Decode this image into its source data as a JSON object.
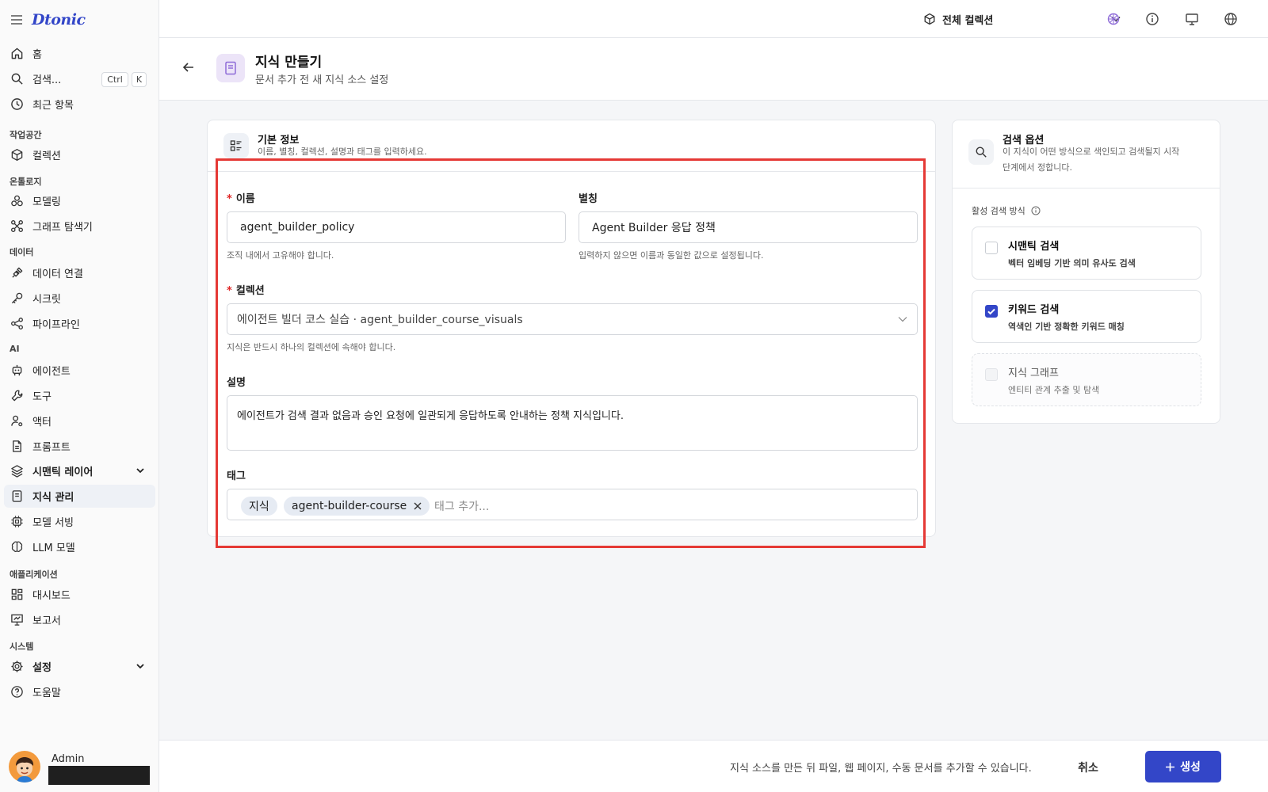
{
  "app": {
    "logo": "Dtonic"
  },
  "sidebar": {
    "home": "홈",
    "search": "검색...",
    "search_kbd": [
      "Ctrl",
      "K"
    ],
    "recent": "최근 항목",
    "sections": {
      "workspace": "작업공간",
      "ontology": "온톨로지",
      "data": "데이터",
      "ai": "AI",
      "apps": "애플리케이션",
      "system": "시스템"
    },
    "items": {
      "collection": "컬렉션",
      "modeling": "모델링",
      "graph_explorer": "그래프 탐색기",
      "data_connection": "데이터 연결",
      "secrets": "시크릿",
      "pipeline": "파이프라인",
      "agent": "에이전트",
      "tools": "도구",
      "actor": "액터",
      "prompt": "프롬프트",
      "semantic_layer": "시맨틱 레이어",
      "knowledge": "지식 관리",
      "model_serving": "모델 서빙",
      "llm_model": "LLM 모델",
      "dashboard": "대시보드",
      "report": "보고서",
      "settings": "설정",
      "help": "도움말"
    },
    "user": {
      "name": "Admin"
    }
  },
  "topbar": {
    "collection_selector": "전체 컬렉션"
  },
  "page": {
    "title": "지식 만들기",
    "subtitle": "문서 추가 전 새 지식 소스 설정"
  },
  "basic_info": {
    "title": "기본 정보",
    "subtitle": "이름, 별칭, 컬렉션, 설명과 태그를 입력하세요.",
    "name_label": "이름",
    "name_value": "agent_builder_policy",
    "name_hint": "조직 내에서 고유해야 합니다.",
    "alias_label": "별칭",
    "alias_value": "Agent Builder 응답 정책",
    "alias_hint": "입력하지 않으면 이름과 동일한 값으로 설정됩니다.",
    "collection_label": "컬렉션",
    "collection_value": "에이전트 빌더 코스 실습 · agent_builder_course_visuals",
    "collection_hint": "지식은 반드시 하나의 컬렉션에 속해야 합니다.",
    "description_label": "설명",
    "description_value": "에이전트가 검색 결과 없음과 승인 요청에 일관되게 응답하도록 안내하는 정책 지식입니다.",
    "tags_label": "태그",
    "tags": [
      "지식",
      "agent-builder-course"
    ],
    "tags_placeholder": "태그 추가..."
  },
  "search_options": {
    "title": "검색 옵션",
    "subtitle_line1": "이 지식이 어떤 방식으로 색인되고 검색될지 시작",
    "subtitle_line2": "단계에서 정합니다.",
    "active_label": "활성 검색 방식",
    "options": [
      {
        "title": "시맨틱 검색",
        "desc": "벡터 임베딩 기반 의미 유사도 검색",
        "checked": false,
        "disabled": false
      },
      {
        "title": "키워드 검색",
        "desc": "역색인 기반 정확한 키워드 매칭",
        "checked": true,
        "disabled": false
      },
      {
        "title": "지식 그래프",
        "desc": "엔티티 관계 추출 및 탐색",
        "checked": false,
        "disabled": true
      }
    ]
  },
  "footer": {
    "info": "지식 소스를 만든 뒤 파일, 웹 페이지, 수동 문서를 추가할 수 있습니다.",
    "cancel": "취소",
    "create": "생성"
  },
  "colors": {
    "accent": "#3346c8",
    "highlight": "#e53935",
    "required": "#e02424"
  }
}
